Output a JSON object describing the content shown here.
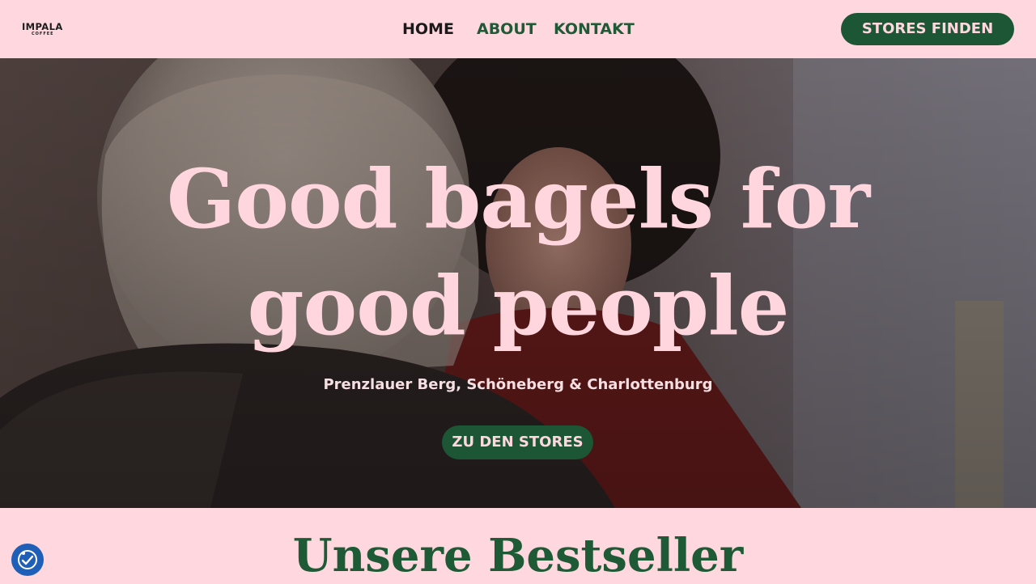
{
  "brand": {
    "logo_main": "IMPALA",
    "logo_sub": "COFFEE"
  },
  "nav": {
    "items": [
      {
        "label": "HOME",
        "active": true
      },
      {
        "label": "ABOUT",
        "active": false
      },
      {
        "label": "KONTAKT",
        "active": false
      }
    ],
    "cta_label": "STORES FINDEN"
  },
  "hero": {
    "title_line1": "Good bagels for",
    "title_line2": "good people",
    "subtitle": "Prenzlauer Berg, Schöneberg & Charlottenburg",
    "cta_label": "ZU DEN STORES"
  },
  "bestseller": {
    "title": "Unsere Bestseller"
  },
  "accessibility": {
    "icon": "accessibility-check-icon"
  },
  "colors": {
    "background_pink": "#ffd8df",
    "brand_green": "#1c5634",
    "hero_text_pink": "#ffd6de",
    "accessibility_blue": "#1f5fb8"
  }
}
